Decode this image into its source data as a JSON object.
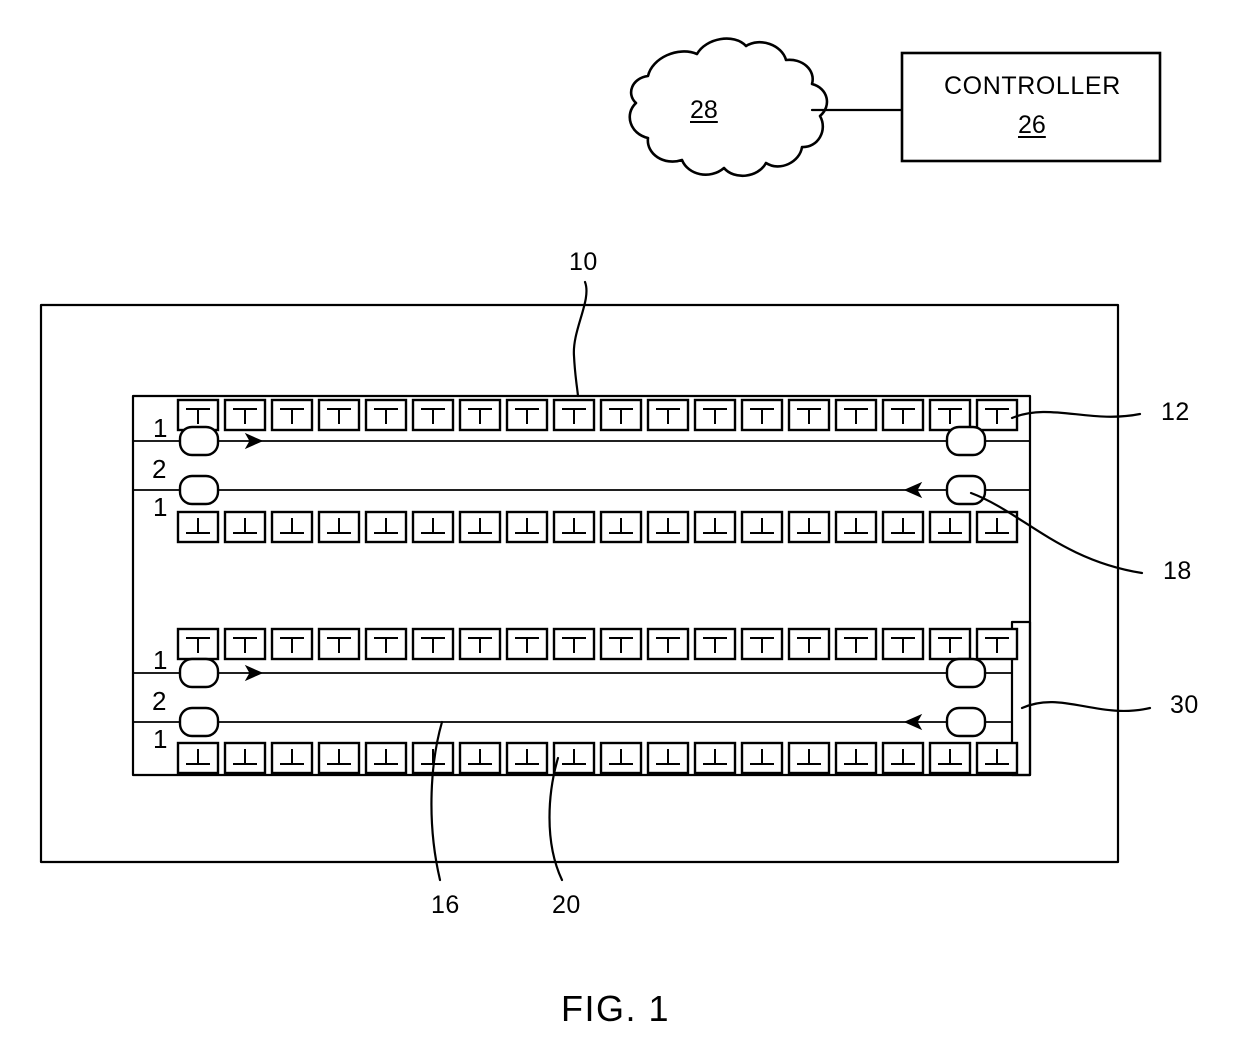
{
  "figure": {
    "caption": "FIG. 1",
    "type": "patent-diagram"
  },
  "network": {
    "cloud_label": "28",
    "cloud_icon": "cloud-icon",
    "controller": {
      "title": "CONTROLLER",
      "number": "26"
    },
    "link_icon": "connection-line-icon"
  },
  "reference_numerals": [
    {
      "id": "10",
      "label": "10",
      "target": "system-enclosure"
    },
    {
      "id": "12",
      "label": "12",
      "target": "rack-assembly"
    },
    {
      "id": "16",
      "label": "16",
      "target": "flow-path"
    },
    {
      "id": "18",
      "label": "18",
      "target": "node-element"
    },
    {
      "id": "20",
      "label": "20",
      "target": "module-cell"
    },
    {
      "id": "30",
      "label": "30",
      "target": "end-bar"
    }
  ],
  "groups": [
    {
      "name": "upper-group",
      "lane_labels": [
        "1",
        "2",
        "1"
      ],
      "top_cell_count": 18,
      "bottom_cell_count": 18,
      "top_cell_glyph": "tee-down-icon",
      "bottom_cell_glyph": "tee-up-icon",
      "forward_arrow_direction": "right",
      "reverse_arrow_direction": "left",
      "node_count": 4,
      "node_icon": "rounded-node-icon"
    },
    {
      "name": "lower-group",
      "lane_labels": [
        "1",
        "2",
        "1"
      ],
      "top_cell_count": 18,
      "bottom_cell_count": 18,
      "top_cell_glyph": "tee-down-icon",
      "bottom_cell_glyph": "tee-up-icon",
      "forward_arrow_direction": "right",
      "reverse_arrow_direction": "left",
      "node_count": 4,
      "node_icon": "rounded-node-icon"
    }
  ]
}
